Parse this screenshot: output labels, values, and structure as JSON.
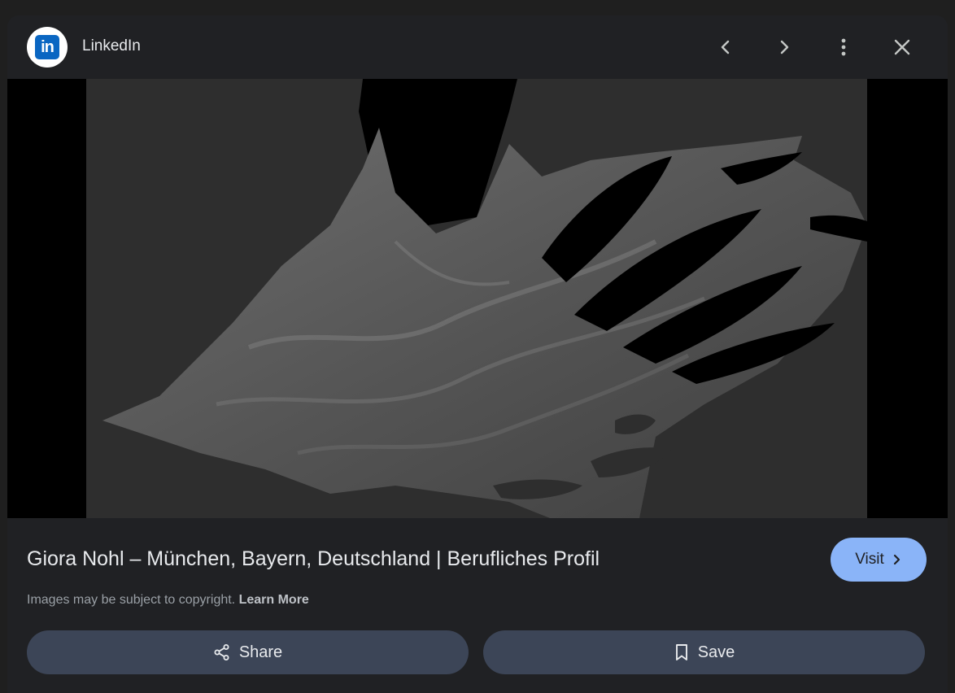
{
  "header": {
    "logo_text": "in",
    "source_name": "LinkedIn",
    "icons": {
      "prev": "chevron-left-icon",
      "next": "chevron-right-icon",
      "more": "more-vert-icon",
      "close": "close-icon"
    }
  },
  "image": {
    "lens_icon": "google-lens-icon"
  },
  "info": {
    "title": "Giora Nohl – München, Bayern, Deutschland | Berufliches Profil",
    "copyright_text": "Images may be subject to copyright.",
    "learn_more": "Learn More",
    "visit_label": "Visit"
  },
  "actions": {
    "share_label": "Share",
    "save_label": "Save"
  },
  "colors": {
    "background": "#202124",
    "accent": "#8ab4f8",
    "action_button": "#3c4557",
    "brand_linkedin": "#0a66c2"
  }
}
